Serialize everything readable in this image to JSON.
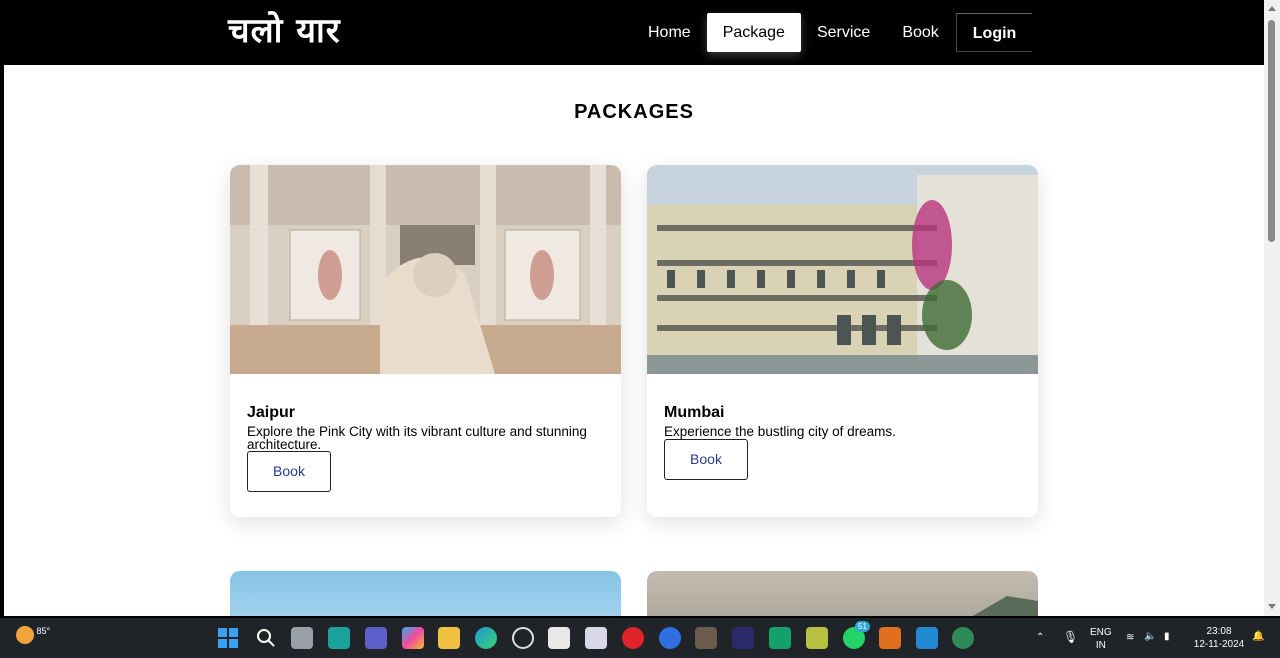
{
  "brand": {
    "logo": "चलो यार"
  },
  "nav": {
    "items": [
      {
        "label": "Home"
      },
      {
        "label": "Package"
      },
      {
        "label": "Service"
      },
      {
        "label": "Book"
      },
      {
        "label": "Login"
      }
    ]
  },
  "page": {
    "title": "PACKAGES"
  },
  "cards": [
    {
      "title": "Jaipur",
      "description": "Explore the Pink City with its vibrant culture and stunning architecture.",
      "button": "Book"
    },
    {
      "title": "Mumbai",
      "description": "Experience the bustling city of dreams.",
      "button": "Book"
    }
  ],
  "taskbar": {
    "weather": "85°",
    "language": "ENG",
    "region": "IN",
    "time": "23:08",
    "date": "12-11-2024",
    "badge": "51"
  },
  "colors": {
    "navbar": "#000000",
    "active_nav_bg": "#ffffff",
    "button_text": "#2a3a8f",
    "taskbar": "#202327"
  }
}
